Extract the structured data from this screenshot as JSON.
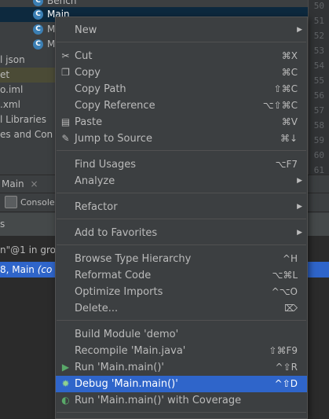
{
  "tree": {
    "items": [
      {
        "label": "Bench",
        "icon": "class-icon"
      },
      {
        "label": "Main",
        "icon": "class-icon"
      },
      {
        "label": "M",
        "icon": "class-icon"
      },
      {
        "label": "M",
        "icon": "class-icon"
      },
      {
        "label": "l json"
      },
      {
        "label": "et"
      },
      {
        "label": "o.iml"
      },
      {
        "label": ".xml"
      },
      {
        "label": "l Libraries"
      },
      {
        "label": "es and Con"
      }
    ],
    "line_numbers": [
      "50",
      "51",
      "52",
      "53",
      "54",
      "55",
      "56",
      "57",
      "58",
      "59",
      "60",
      "61"
    ]
  },
  "bottom": {
    "tab_label": "Main",
    "tab_close": "×",
    "console_label": "Console",
    "frames_header": "s",
    "rows": [
      {
        "text": "n\"@1 in gro"
      },
      {
        "text": "8, Main",
        "italic": "(co"
      }
    ]
  },
  "menu": {
    "items": [
      {
        "label": "New",
        "submenu": true
      },
      {
        "label": "Cut",
        "shortcut": "⌘X",
        "icon": "scissors-icon"
      },
      {
        "label": "Copy",
        "shortcut": "⌘C",
        "icon": "copy-icon"
      },
      {
        "label": "Copy Path",
        "shortcut": "⇧⌘C"
      },
      {
        "label": "Copy Reference",
        "shortcut": "⌥⇧⌘C"
      },
      {
        "label": "Paste",
        "shortcut": "⌘V",
        "icon": "paste-icon"
      },
      {
        "label": "Jump to Source",
        "shortcut": "⌘↓",
        "icon": "pencil-icon"
      },
      {
        "label": "Find Usages",
        "shortcut": "⌥F7"
      },
      {
        "label": "Analyze",
        "submenu": true
      },
      {
        "label": "Refactor",
        "submenu": true
      },
      {
        "label": "Add to Favorites",
        "submenu": true
      },
      {
        "label": "Browse Type Hierarchy",
        "shortcut": "^H"
      },
      {
        "label": "Reformat Code",
        "shortcut": "⌥⌘L"
      },
      {
        "label": "Optimize Imports",
        "shortcut": "^⌥O"
      },
      {
        "label": "Delete...",
        "shortcut": "⌦"
      },
      {
        "label": "Build Module 'demo'"
      },
      {
        "label": "Recompile 'Main.java'",
        "shortcut": "⇧⌘F9"
      },
      {
        "label": "Run 'Main.main()'",
        "shortcut": "^⇧R",
        "icon": "run-icon"
      },
      {
        "label": "Debug 'Main.main()'",
        "shortcut": "^⇧D",
        "icon": "debug-icon",
        "selected": true
      },
      {
        "label": "Run 'Main.main()' with Coverage",
        "icon": "coverage-icon"
      }
    ]
  },
  "colors": {
    "menu_bg": "#3c3f41",
    "selection": "#2f65ca",
    "run_green": "#59a869"
  }
}
